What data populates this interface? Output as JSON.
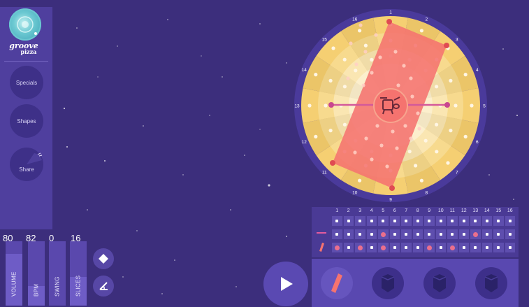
{
  "app": {
    "logo_line1": "groove",
    "logo_line2": "pizza",
    "colors": {
      "background": "#3c2e7c",
      "sidebar": "#4f3f9e",
      "crust": "#f2c76a",
      "shape": "#f5736f",
      "active_step": "#ea6f8d"
    }
  },
  "sidebar": {
    "items": [
      {
        "label": "Specials",
        "icon": "specials-icon"
      },
      {
        "label": "Shapes",
        "icon": "shapes-icon"
      },
      {
        "label": "Share",
        "icon": "share-icon"
      }
    ]
  },
  "controls": {
    "volume": {
      "label": "VOLUME",
      "value": "80",
      "level": 0.8
    },
    "bpm": {
      "label": "BPM",
      "value": "82",
      "level": 0.3
    },
    "swing": {
      "label": "SWING",
      "value": "0",
      "level": 0
    },
    "slices": {
      "label": "SLICES",
      "value": "16",
      "level": 0.45
    }
  },
  "tools": {
    "diamond": "diamond-icon",
    "angle": "angle-icon"
  },
  "pizza": {
    "slice_numbers": [
      "1",
      "2",
      "3",
      "4",
      "5",
      "6",
      "7",
      "8",
      "9",
      "10",
      "11",
      "12",
      "13",
      "14",
      "15",
      "16"
    ],
    "center_icon": "drum-kit-icon"
  },
  "sequencer": {
    "step_numbers": [
      "1",
      "2",
      "3",
      "4",
      "5",
      "6",
      "7",
      "8",
      "9",
      "10",
      "11",
      "12",
      "13",
      "14",
      "15",
      "16"
    ],
    "rows": [
      {
        "name": "row-1",
        "icon": "",
        "active": []
      },
      {
        "name": "row-2",
        "icon": "line-shape-icon",
        "active": [
          5,
          13
        ]
      },
      {
        "name": "row-3",
        "icon": "rectangle-shape-icon",
        "active": [
          1,
          3,
          5,
          9,
          11
        ]
      }
    ]
  },
  "play": {
    "icon": "play-icon"
  },
  "shape_bar": {
    "slots": [
      "rectangle-shape-icon",
      "drum-icon",
      "drum-icon",
      "drum-icon"
    ]
  }
}
